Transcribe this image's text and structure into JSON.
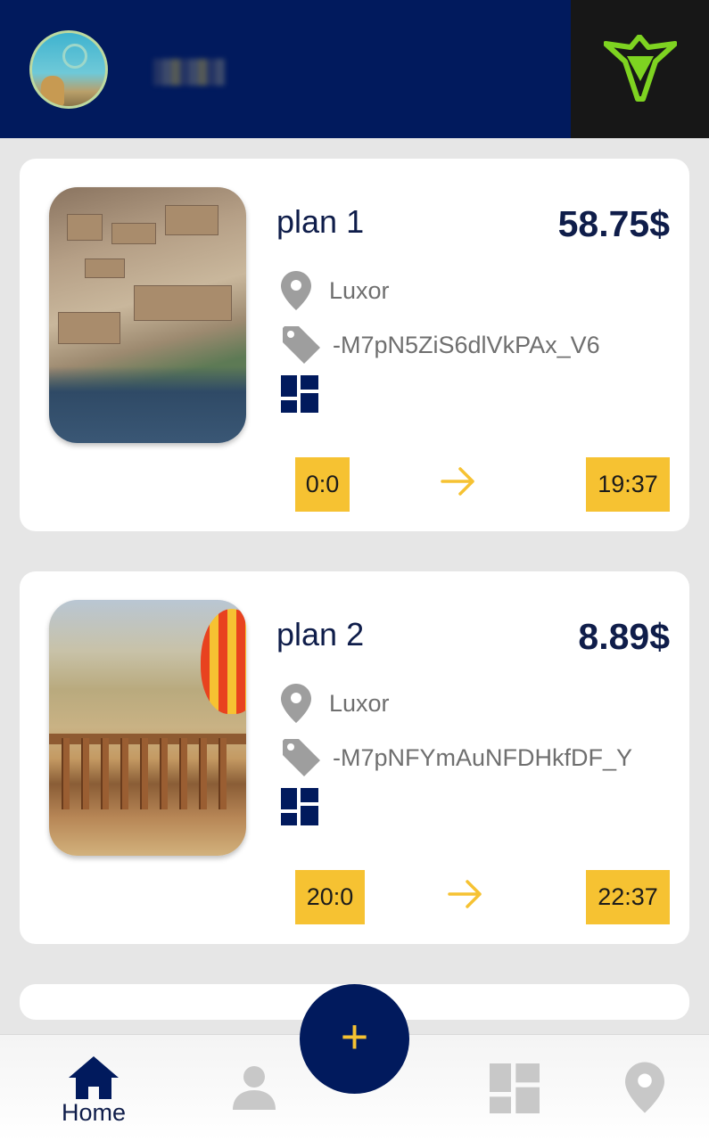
{
  "header": {
    "avatar_name": "user-avatar",
    "brand_color": "#011a5d"
  },
  "plans": [
    {
      "title": "plan 1",
      "price": "58.75$",
      "location": "Luxor",
      "tag": "-M7pN5ZiS6dlVkPAx_V6",
      "start_time": "0:0",
      "end_time": "19:37"
    },
    {
      "title": "plan 2",
      "price": "8.89$",
      "location": "Luxor",
      "tag": "-M7pNFYmAuNFDHkfDF_Y",
      "start_time": "20:0",
      "end_time": "22:37"
    }
  ],
  "nav": {
    "home_label": "Home",
    "add_symbol": "+"
  },
  "colors": {
    "accent": "#f6c232",
    "navy": "#011a5d",
    "text_dark": "#0f1d4a",
    "icon_gray": "#9e9e9e",
    "logo_green": "#7ed321"
  }
}
